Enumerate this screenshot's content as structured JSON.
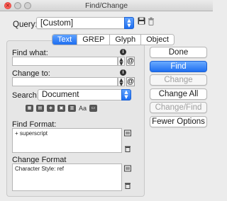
{
  "window": {
    "title": "Find/Change"
  },
  "query": {
    "label": "Query:",
    "value": "[Custom]"
  },
  "tabs": [
    {
      "label": "Text",
      "active": true
    },
    {
      "label": "GREP",
      "active": false
    },
    {
      "label": "Glyph",
      "active": false
    },
    {
      "label": "Object",
      "active": false
    }
  ],
  "find": {
    "label": "Find what:",
    "value": ""
  },
  "change": {
    "label": "Change to:",
    "value": ""
  },
  "search": {
    "label": "Search:",
    "value": "Document"
  },
  "options_icons": [
    "lock-layers-icon",
    "locked-stories-icon",
    "hidden-layers-icon",
    "master-pages-icon",
    "footnotes-icon",
    "case-sensitive-icon",
    "whole-word-icon"
  ],
  "case_icon_text": "Aa",
  "find_format": {
    "label": "Find Format:",
    "value": "+ superscript"
  },
  "change_format": {
    "label": "Change Format",
    "value": "Character Style: ref"
  },
  "buttons": {
    "done": "Done",
    "find": "Find",
    "change": "Change",
    "change_all": "Change All",
    "change_find": "Change/Find",
    "fewer_options": "Fewer Options"
  },
  "colors": {
    "accent": "#1e6ef0",
    "disabled_text": "#a0a0a0"
  }
}
